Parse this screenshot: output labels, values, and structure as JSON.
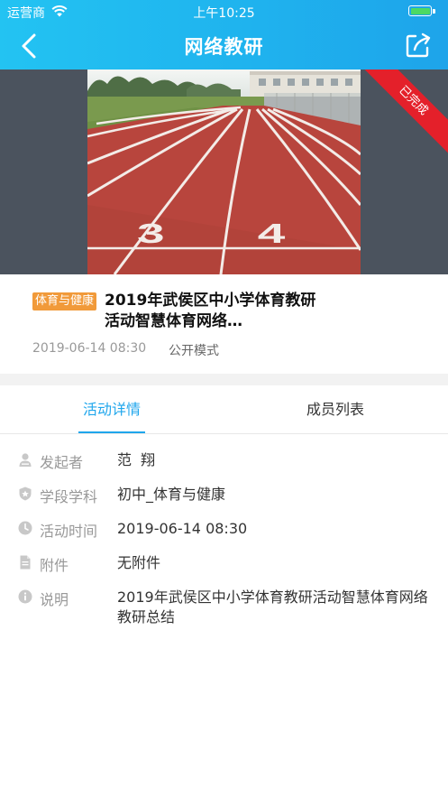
{
  "status_bar": {
    "carrier": "运营商",
    "time": "上午10:25"
  },
  "nav": {
    "title": "网络教研",
    "back_icon": "chevron-left-icon",
    "share_icon": "share-icon"
  },
  "banner": {
    "status_ribbon": "已完成",
    "image_subject": "running track with lane numbers",
    "lane_numbers": [
      "3",
      "4"
    ]
  },
  "activity": {
    "tag": "体育与健康",
    "title": "2019年武侯区中小学体育教研活动智慧体育网络…",
    "date": "2019-06-14 08:30",
    "mode": "公开模式"
  },
  "tabs": [
    {
      "label": "活动详情",
      "active": true
    },
    {
      "label": "成员列表",
      "active": false
    }
  ],
  "details": [
    {
      "icon": "person-icon",
      "label": "发起者",
      "value": "范  翔"
    },
    {
      "icon": "shield-icon",
      "label": "学段学科",
      "value": "初中_体育与健康"
    },
    {
      "icon": "clock-icon",
      "label": "活动时间",
      "value": "2019-06-14 08:30"
    },
    {
      "icon": "document-icon",
      "label": "附件",
      "value": "无附件"
    },
    {
      "icon": "info-icon",
      "label": "说明",
      "value": "2019年武侯区中小学体育教研活动智慧体育网络教研总结"
    }
  ],
  "colors": {
    "header_start": "#23c3f2",
    "header_end": "#1ea4ea",
    "accent": "#1fa6ec",
    "tag": "#f19a3a",
    "ribbon": "#e4202a",
    "track": "#b8453d"
  }
}
